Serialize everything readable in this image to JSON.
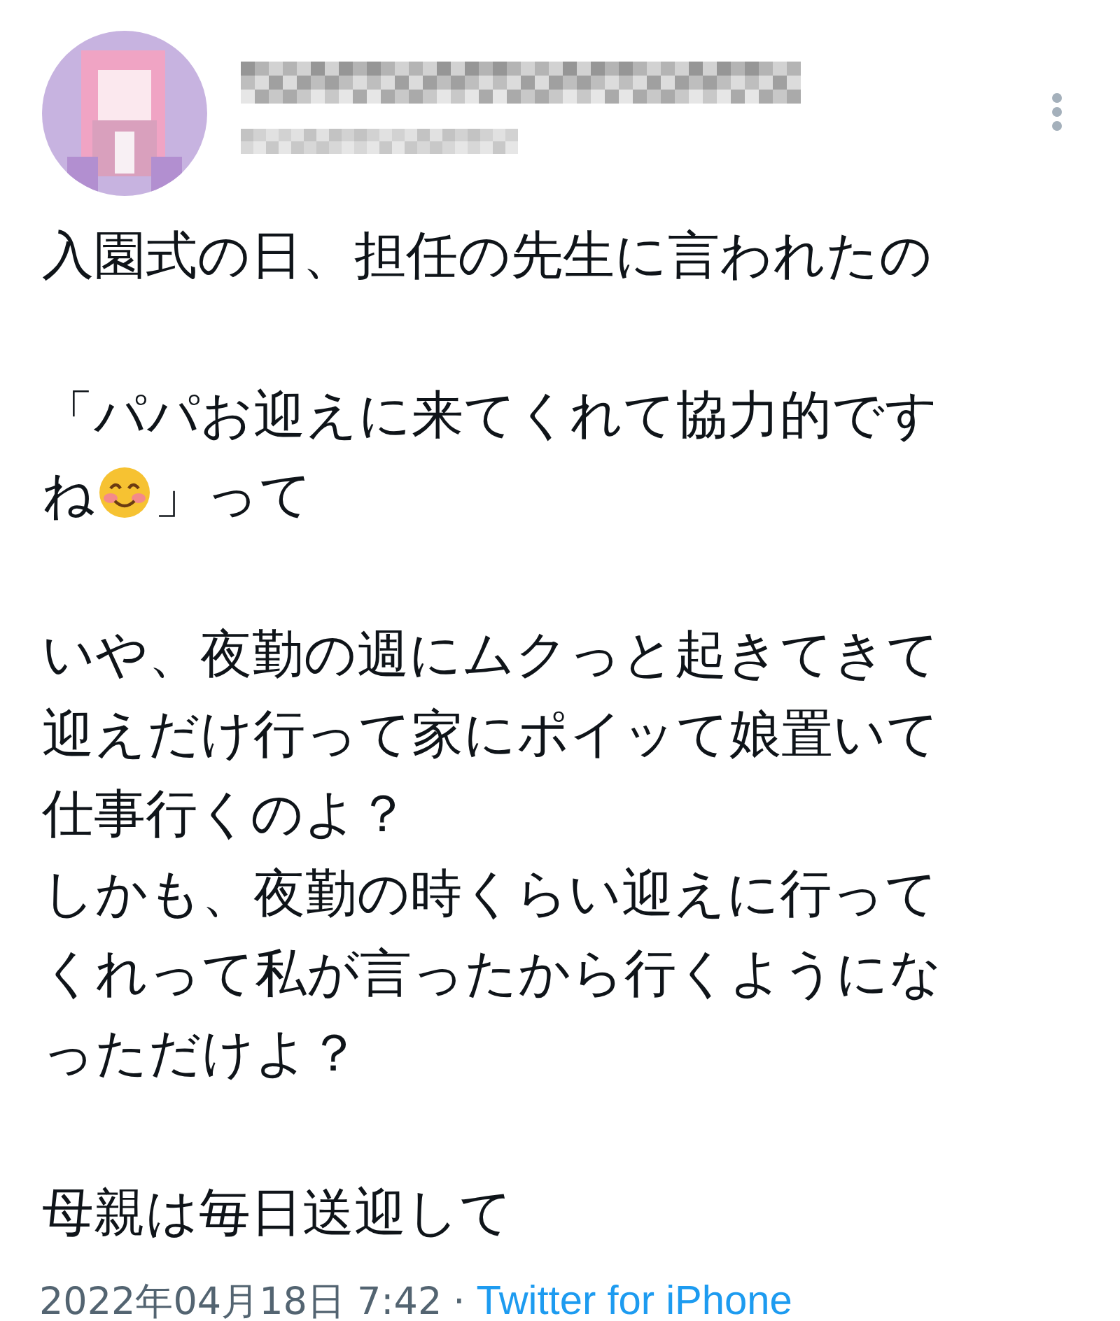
{
  "tweet": {
    "paragraphs": [
      [
        {
          "parts": [
            {
              "kind": "text",
              "text": "入園式の日、担任の先生に言われたの"
            }
          ]
        }
      ],
      [
        {
          "parts": [
            {
              "kind": "text",
              "text": "「パパお迎えに来てくれて協力的です"
            }
          ]
        },
        {
          "parts": [
            {
              "kind": "text",
              "text": "ね"
            },
            {
              "kind": "emoji"
            },
            {
              "kind": "text",
              "text": "」って"
            }
          ]
        }
      ],
      [
        {
          "parts": [
            {
              "kind": "text",
              "text": "いや、夜勤の週にムクっと起きてきて"
            }
          ]
        },
        {
          "parts": [
            {
              "kind": "text",
              "text": "迎えだけ行って家にポイッて娘置いて"
            }
          ]
        },
        {
          "parts": [
            {
              "kind": "text",
              "text": "仕事行くのよ？"
            }
          ]
        },
        {
          "parts": [
            {
              "kind": "text",
              "text": "しかも、夜勤の時くらい迎えに行って"
            }
          ]
        },
        {
          "parts": [
            {
              "kind": "text",
              "text": "くれって私が言ったから行くようにな"
            }
          ]
        },
        {
          "parts": [
            {
              "kind": "text",
              "text": "っただけよ？"
            }
          ]
        }
      ],
      [
        {
          "parts": [
            {
              "kind": "text",
              "text": "母親は毎日送迎して"
            }
          ]
        }
      ]
    ],
    "timestamp": "2022年04月18日 7:42",
    "separator": "·",
    "source": "Twitter for iPhone"
  }
}
